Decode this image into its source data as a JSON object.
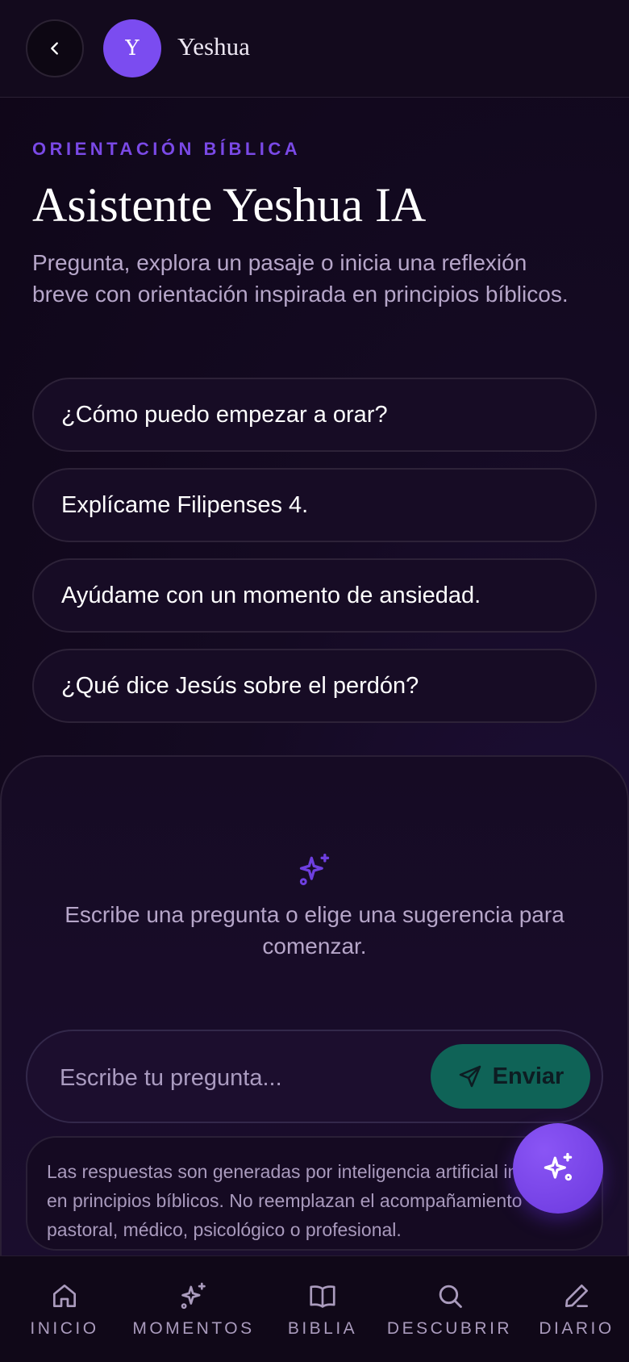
{
  "header": {
    "avatar_letter": "Y",
    "title": "Yeshua"
  },
  "intro": {
    "eyebrow": "ORIENTACIÓN BÍBLICA",
    "title": "Asistente Yeshua IA",
    "subtitle": "Pregunta, explora un pasaje o inicia una reflexión breve con orientación inspirada en principios bíblicos."
  },
  "suggestions": [
    {
      "label": "¿Cómo puedo empezar a orar?"
    },
    {
      "label": "Explícame Filipenses 4."
    },
    {
      "label": "Ayúdame con un momento de ansiedad."
    },
    {
      "label": "¿Qué dice Jesús sobre el perdón?"
    }
  ],
  "chat": {
    "empty_text": "Escribe una pregunta o elige una sugerencia para comenzar.",
    "input_placeholder": "Escribe tu pregunta...",
    "input_value": "",
    "send_label": "Enviar",
    "disclaimer": "Las respuestas son generadas por inteligencia artificial inspirada en principios bíblicos. No reemplazan el acompañamiento pastoral, médico, psicológico o profesional."
  },
  "nav": {
    "items": [
      {
        "label": "INICIO",
        "icon": "home-icon"
      },
      {
        "label": "MOMENTOS",
        "icon": "sparkles-icon"
      },
      {
        "label": "BIBLIA",
        "icon": "book-icon"
      },
      {
        "label": "DESCUBRIR",
        "icon": "search-icon"
      },
      {
        "label": "DIARIO",
        "icon": "pen-icon"
      }
    ]
  },
  "colors": {
    "accent": "#7b4cf0",
    "send_button": "#0f6357",
    "background": "#12081c"
  }
}
